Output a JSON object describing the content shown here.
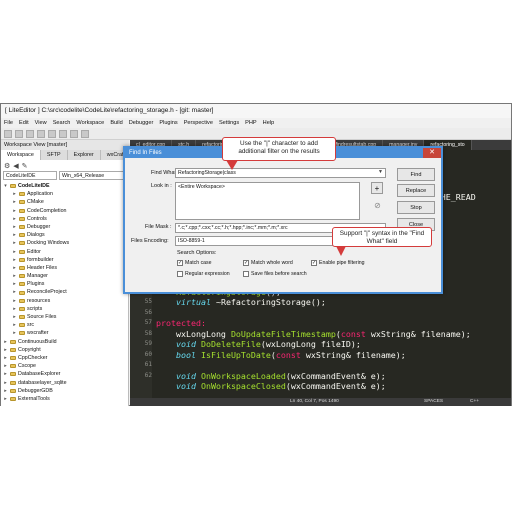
{
  "window": {
    "title": "[ LiteEditor ] C:\\src\\codelite\\CodeLite\\refactoring_storage.h - [git: master]"
  },
  "menu": [
    "File",
    "Edit",
    "View",
    "Search",
    "Workspace",
    "Build",
    "Debugger",
    "Plugins",
    "Perspective",
    "Settings",
    "PHP",
    "Help"
  ],
  "workspace": {
    "title": "Workspace View [master]",
    "tabs": [
      "Workspace",
      "SFTP",
      "Explorer",
      "wxCrafter"
    ],
    "project_combo": "CodeLiteIDE",
    "config_combo": "Win_x64_Release",
    "tree": [
      {
        "label": "CodeLiteIDE",
        "level": 0,
        "expanded": true,
        "bold": true
      },
      {
        "label": "Application",
        "level": 1
      },
      {
        "label": "CMake",
        "level": 1
      },
      {
        "label": "CodeCompletion",
        "level": 1
      },
      {
        "label": "Controls",
        "level": 1
      },
      {
        "label": "Debugger",
        "level": 1
      },
      {
        "label": "Dialogs",
        "level": 1
      },
      {
        "label": "Docking Windows",
        "level": 1
      },
      {
        "label": "Editor",
        "level": 1
      },
      {
        "label": "formbuilder",
        "level": 1
      },
      {
        "label": "Header Files",
        "level": 1
      },
      {
        "label": "Manager",
        "level": 1
      },
      {
        "label": "Plugins",
        "level": 1
      },
      {
        "label": "ReconcileProject",
        "level": 1
      },
      {
        "label": "resources",
        "level": 1
      },
      {
        "label": "scripts",
        "level": 1
      },
      {
        "label": "Source Files",
        "level": 1
      },
      {
        "label": "src",
        "level": 1
      },
      {
        "label": "wxcrafter",
        "level": 1
      },
      {
        "label": "ContinuousBuild",
        "level": 0
      },
      {
        "label": "Copyright",
        "level": 0
      },
      {
        "label": "CppChecker",
        "level": 0
      },
      {
        "label": "Cscope",
        "level": 0
      },
      {
        "label": "DatabaseExplorer",
        "level": 0
      },
      {
        "label": "databaselayer_sqlite",
        "level": 0
      },
      {
        "label": "DebuggerGDB",
        "level": 0
      },
      {
        "label": "ExternalTools",
        "level": 0
      }
    ]
  },
  "editor": {
    "tabs": [
      "cl_editor.cpp",
      "stc.h",
      "refactoring_storage.cpp",
      "app.cpp",
      "macros.h",
      "findresultstab.cpp",
      "manager.inv",
      "refactoring_sto"
    ],
    "line_numbers": [
      "",
      "",
      "",
      "",
      "",
      "",
      "",
      "",
      "",
      "",
      "",
      "",
      "53",
      "54",
      "55",
      "56",
      "57",
      "58",
      "59",
      "60",
      "61",
      "62"
    ],
    "code_lines": [
      [
        {
          "t": "#includ"
        }
      ],
      [
        {
          "t": ""
        }
      ],
      [
        {
          "t": "                                                   ndler"
        }
      ],
      [
        {
          "t": ""
        }
      ],
      [
        {
          "t": "                                                   S, CACHE_READ"
        }
      ],
      [
        {
          "t": ""
        }
      ],
      [
        {
          "t": ""
        }
      ],
      [
        {
          "t": ""
        }
      ],
      [
        {
          "t": ""
        }
      ],
      [
        {
          "t": ""
        }
      ],
      [
        {
          "t": ""
        }
      ],
      [
        {
          "t": ""
        }
      ],
      [
        {
          "t": "public:",
          "c": "kw"
        }
      ],
      [
        {
          "t": "    "
        },
        {
          "t": "RefactoringStorage",
          "c": "fn"
        },
        {
          "t": "();"
        }
      ],
      [
        {
          "t": "    "
        },
        {
          "t": "virtual",
          "c": "ty"
        },
        {
          "t": " ~RefactoringStorage();"
        }
      ],
      [
        {
          "t": ""
        }
      ],
      [
        {
          "t": "protected:",
          "c": "kw"
        }
      ],
      [
        {
          "t": "    wxLongLong "
        },
        {
          "t": "DoUpdateFileTimestamp",
          "c": "fn"
        },
        {
          "t": "("
        },
        {
          "t": "const",
          "c": "kw"
        },
        {
          "t": " wxString& filename);"
        }
      ],
      [
        {
          "t": "    "
        },
        {
          "t": "void",
          "c": "ty"
        },
        {
          "t": " "
        },
        {
          "t": "DoDeleteFile",
          "c": "fn"
        },
        {
          "t": "(wxLongLong fileID);"
        }
      ],
      [
        {
          "t": "    "
        },
        {
          "t": "bool",
          "c": "ty"
        },
        {
          "t": " "
        },
        {
          "t": "IsFileUpToDate",
          "c": "fn"
        },
        {
          "t": "("
        },
        {
          "t": "const",
          "c": "kw"
        },
        {
          "t": " wxString& filename);"
        }
      ],
      [
        {
          "t": ""
        }
      ],
      [
        {
          "t": "    "
        },
        {
          "t": "void",
          "c": "ty"
        },
        {
          "t": " "
        },
        {
          "t": "OnWorkspaceLoaded",
          "c": "fn"
        },
        {
          "t": "(wxCommandEvent& e);"
        }
      ],
      [
        {
          "t": "    "
        },
        {
          "t": "void",
          "c": "ty"
        },
        {
          "t": " "
        },
        {
          "t": "OnWorkspaceClosed",
          "c": "fn"
        },
        {
          "t": "(wxCommandEvent& e);"
        }
      ]
    ]
  },
  "status": {
    "position": "Ln 40, Col 7, Pos 1490",
    "indent": "SPACES",
    "lang": "C++"
  },
  "dialog": {
    "title": "Find In Files",
    "find_what_label": "Find What :",
    "find_what_value": "RefactoringStorage|class",
    "look_in_label": "Look in :",
    "look_in_value": "<Entire Workspace>",
    "file_mask_label": "File Mask :",
    "file_mask_value": "*.c;*.cpp;*.cxx;*.cc;*.h;*.hpp;*.inc;*.mm;*.m;*.xrc",
    "encoding_label": "Files Encoding:",
    "encoding_value": "ISO-8859-1",
    "search_options_label": "Search Options:",
    "options": [
      {
        "label": "Match case",
        "checked": true
      },
      {
        "label": "Match whole word",
        "checked": true
      },
      {
        "label": "Enable pipe filtering",
        "checked": true
      },
      {
        "label": "Regular expression",
        "checked": false
      },
      {
        "label": "Save files before search",
        "checked": false
      }
    ],
    "buttons": {
      "find": "Find",
      "replace": "Replace",
      "stop": "Stop",
      "close": "Close"
    },
    "close_glyph": "✕",
    "plus_glyph": "+",
    "clear_glyph": "⊘"
  },
  "callouts": {
    "top": "Use the \"|\" character to add additional filter on the results",
    "bottom": "Support \"|\" syntax in the \"Find What\" field"
  }
}
